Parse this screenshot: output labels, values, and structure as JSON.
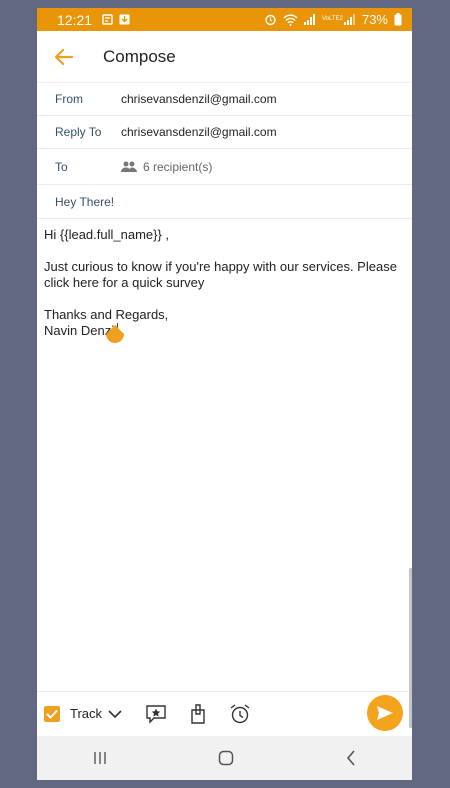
{
  "status": {
    "time": "12:21",
    "network": "VoLTE2",
    "battery": "73%"
  },
  "header": {
    "title": "Compose"
  },
  "fields": {
    "from_label": "From",
    "from_value": "chrisevansdenzil@gmail.com",
    "reply_to_label": "Reply To",
    "reply_to_value": "chrisevansdenzil@gmail.com",
    "to_label": "To",
    "to_value": "6 recipient(s)",
    "subject": "Hey There!"
  },
  "body": {
    "line1": "Hi {{lead.full_name}} ,",
    "line2": "Just curious to know if you're happy with our services. Please click here for a quick survey",
    "line3": "Thanks and Regards,",
    "line4": "Navin Denzil"
  },
  "toolbar": {
    "track_label": "Track",
    "track_checked": true
  },
  "colors": {
    "accent": "#e8950a",
    "background": "#636882"
  },
  "icons": [
    "back-arrow-icon",
    "people-icon",
    "chevron-down-icon",
    "rating-icon",
    "attachment-icon",
    "alarm-icon",
    "send-icon"
  ]
}
